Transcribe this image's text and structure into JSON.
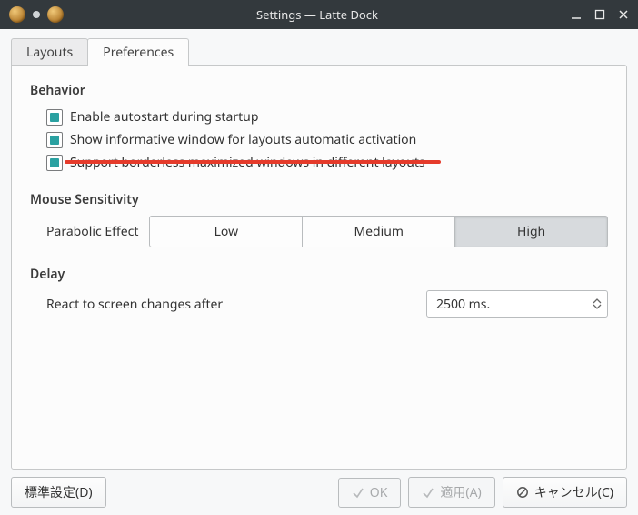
{
  "window": {
    "title": "Settings — Latte Dock"
  },
  "tabs": {
    "layouts": "Layouts",
    "preferences": "Preferences",
    "active": "preferences"
  },
  "behavior": {
    "title": "Behavior",
    "items": [
      {
        "label": "Enable autostart during startup",
        "checked": true
      },
      {
        "label": "Show informative window for layouts automatic activation",
        "checked": true
      },
      {
        "label": "Support borderless maximized windows in different layouts",
        "checked": true
      }
    ]
  },
  "mouse": {
    "title": "Mouse Sensitivity",
    "parabolic_label": "Parabolic Effect",
    "options": {
      "low": "Low",
      "medium": "Medium",
      "high": "High"
    },
    "selected": "high"
  },
  "delay": {
    "title": "Delay",
    "label": "React to screen changes after",
    "value": "2500 ms."
  },
  "buttons": {
    "defaults": "標準設定(D)",
    "ok": "OK",
    "apply": "適用(A)",
    "cancel": "キャンセル(C)"
  }
}
